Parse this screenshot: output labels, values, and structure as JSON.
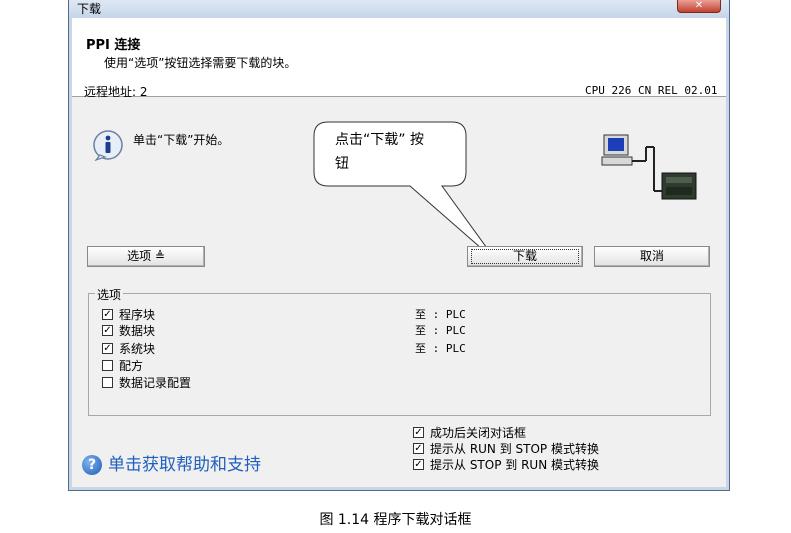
{
  "window": {
    "title": "下载",
    "close_label": "✕"
  },
  "header": {
    "title": "PPI 连接",
    "description": "使用“选项”按钮选择需要下载的块。"
  },
  "connection": {
    "remote_address": "远程地址: 2",
    "cpu_info": "CPU 226 CN REL 02.01"
  },
  "info": {
    "icon": "info-icon",
    "text": "单击“下载”开始。"
  },
  "callout": {
    "line1": "点击“下载” 按",
    "line2": "钮"
  },
  "buttons": {
    "options": "选项 ≜",
    "download": "下载",
    "cancel": "取消"
  },
  "options_group": {
    "legend": "选项",
    "items": [
      {
        "label": "程序块",
        "checked": true,
        "target": "至 : PLC"
      },
      {
        "label": "数据块",
        "checked": true,
        "target": "至 : PLC"
      },
      {
        "label": "系统块",
        "checked": true,
        "target": "至 : PLC"
      },
      {
        "label": "配方",
        "checked": false
      },
      {
        "label": "数据记录配置",
        "checked": false
      }
    ]
  },
  "bottom_options": [
    {
      "label": "成功后关闭对话框",
      "checked": true
    },
    {
      "label": "提示从 RUN 到 STOP 模式转换",
      "checked": true
    },
    {
      "label": "提示从 STOP 到 RUN 模式转换",
      "checked": true
    }
  ],
  "help": {
    "icon": "help-icon",
    "text": "单击获取帮助和支持"
  },
  "caption": "图 1.14  程序下载对话框",
  "colors": {
    "link": "#1f5fbf",
    "frame": "#c9d6e6"
  }
}
